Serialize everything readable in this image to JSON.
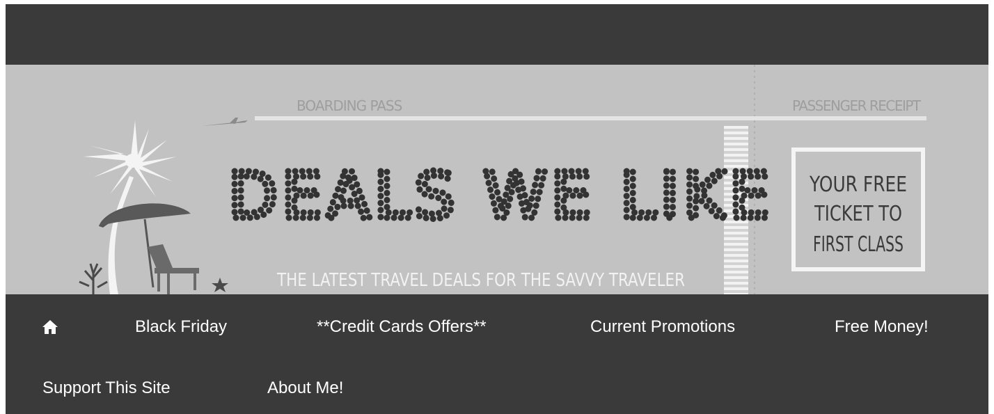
{
  "header": {
    "boarding_pass": "BOARDING PASS",
    "passenger_receipt": "PASSENGER RECEIPT",
    "title": "DEALS WE LIKE",
    "tagline": "THE LATEST TRAVEL DEALS FOR THE SAVVY TRAVELER",
    "ticket_lines": [
      "YOUR FREE",
      "TICKET TO",
      "FIRST CLASS"
    ]
  },
  "nav": {
    "home_icon": "home-icon",
    "items": [
      {
        "label": "Black Friday"
      },
      {
        "label": "**Credit Cards Offers**"
      },
      {
        "label": "Current Promotions"
      },
      {
        "label": "Free Money!"
      },
      {
        "label": "Support This Site"
      },
      {
        "label": "About Me!"
      }
    ]
  },
  "colors": {
    "bar": "#3a3a3a",
    "banner": "#c2c2c2",
    "title": "#333333",
    "nav_text": "#ffffff"
  }
}
